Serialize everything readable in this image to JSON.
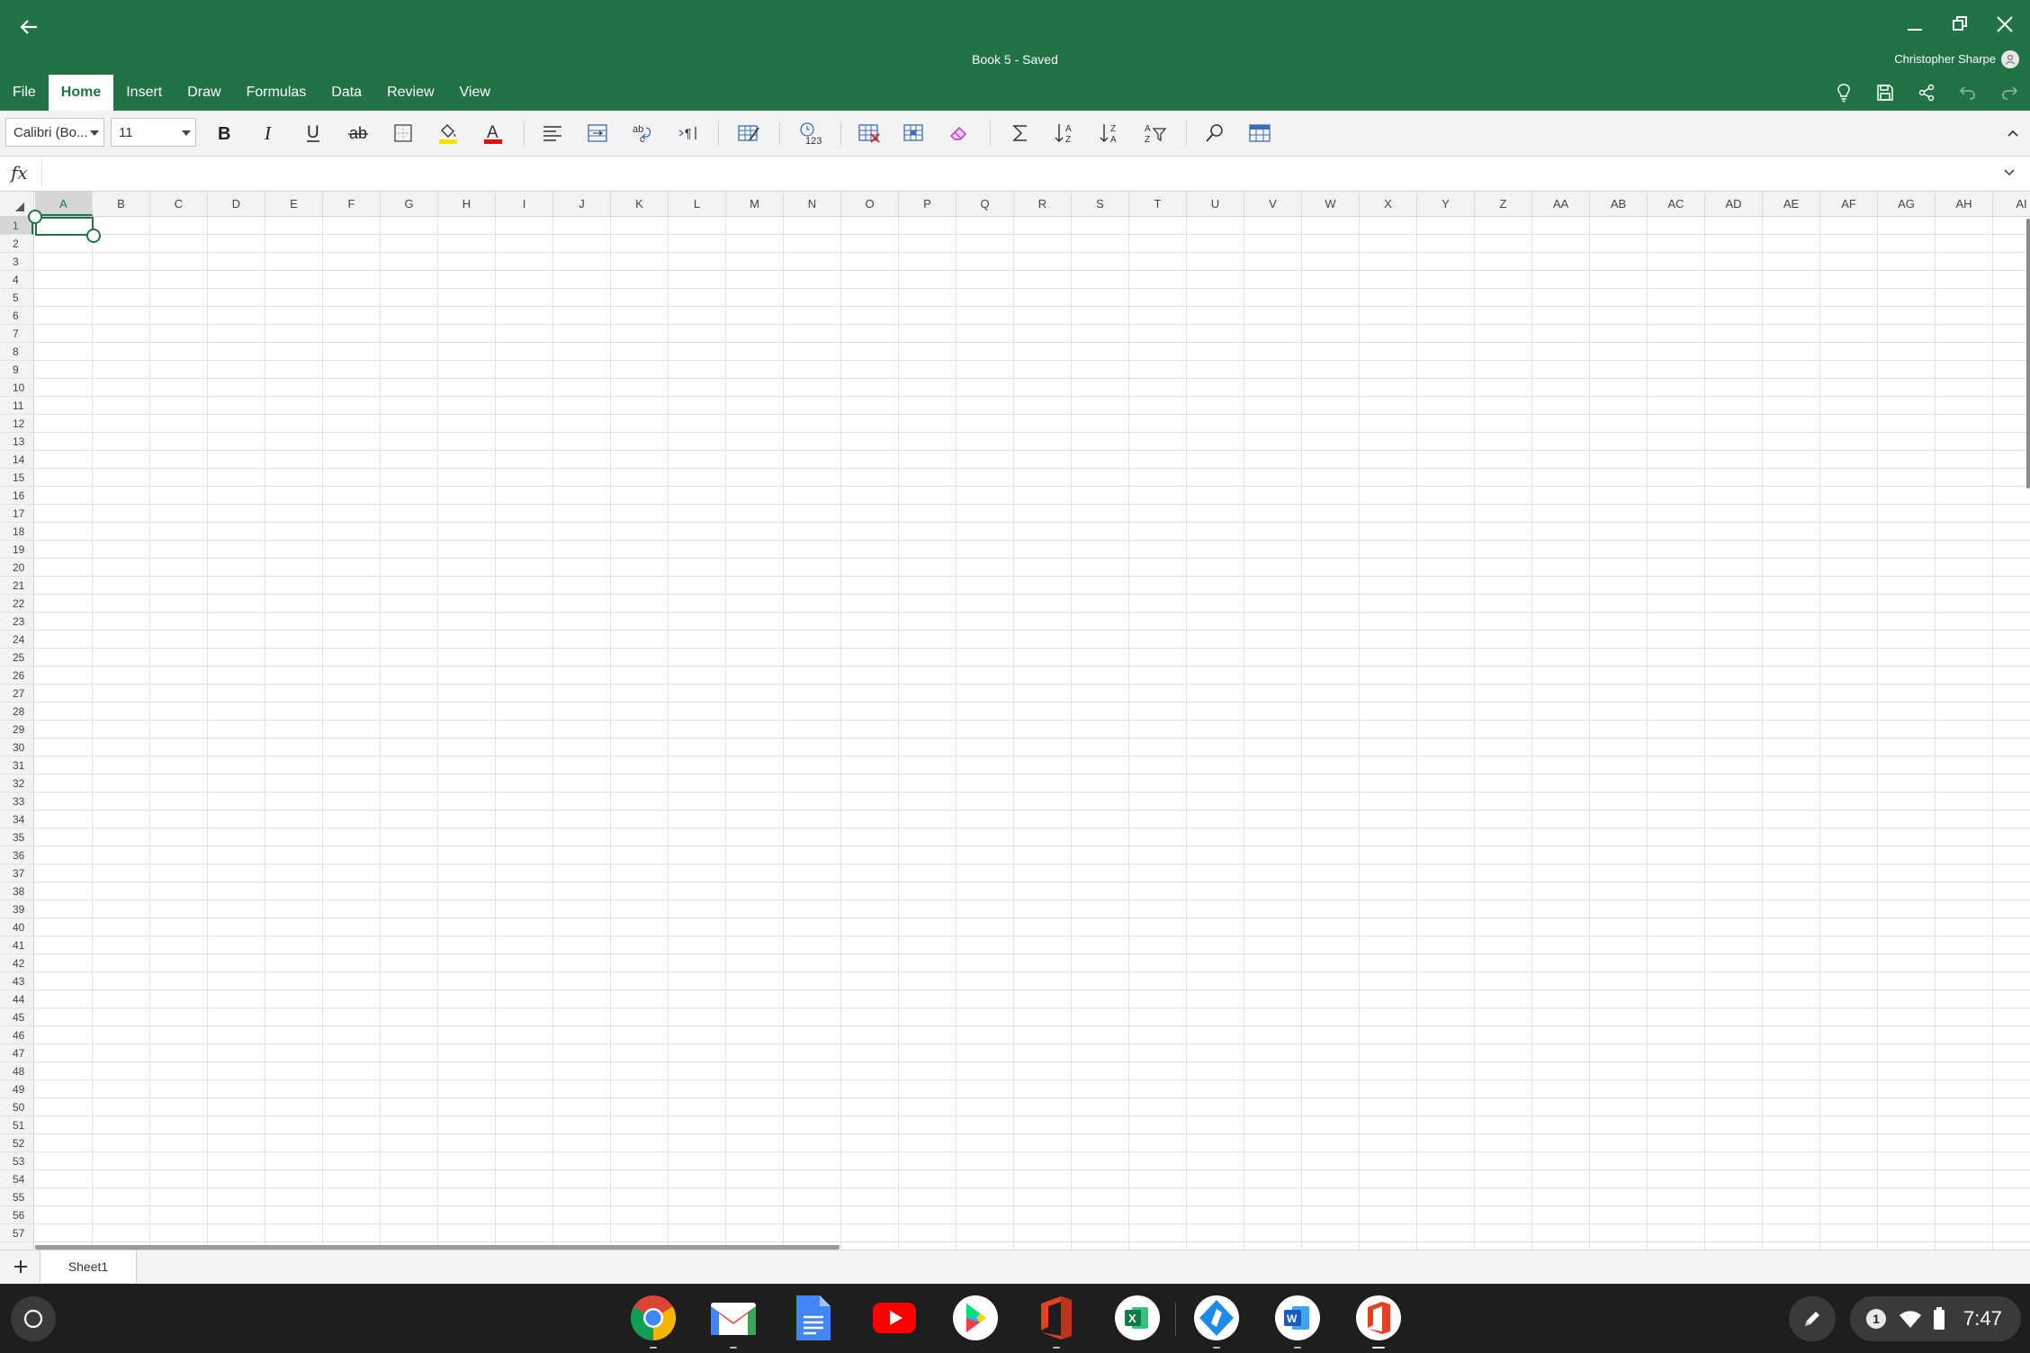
{
  "app": {
    "doc_title": "Book 5 - Saved",
    "user_name": "Christopher Sharpe",
    "accent": "#217346"
  },
  "tabs": [
    {
      "label": "File",
      "active": false
    },
    {
      "label": "Home",
      "active": true
    },
    {
      "label": "Insert",
      "active": false
    },
    {
      "label": "Draw",
      "active": false
    },
    {
      "label": "Formulas",
      "active": false
    },
    {
      "label": "Data",
      "active": false
    },
    {
      "label": "Review",
      "active": false
    },
    {
      "label": "View",
      "active": false
    }
  ],
  "header_icons": [
    "lightbulb-icon",
    "save-icon",
    "share-icon",
    "undo-icon",
    "redo-icon"
  ],
  "ribbon": {
    "font_name": "Calibri (Bo...",
    "font_size": "11",
    "buttons": [
      "bold-icon",
      "italic-icon",
      "underline-icon",
      "strikethrough-icon",
      "borders-icon",
      "fill-color-icon",
      "font-color-icon",
      "align-icon",
      "merge-icon",
      "wrap-text-icon",
      "text-direction-icon",
      "format-table-icon",
      "number-format-icon",
      "delete-cells-icon",
      "format-cells-icon",
      "clear-icon",
      "autosum-icon",
      "sort-ascending-icon",
      "sort-descending-icon",
      "filter-icon",
      "find-icon",
      "table-view-icon"
    ]
  },
  "formula_bar": {
    "fx_label": "fx",
    "value": ""
  },
  "grid": {
    "columns": [
      "A",
      "B",
      "C",
      "D",
      "E",
      "F",
      "G",
      "H",
      "I",
      "J",
      "K",
      "L",
      "M",
      "N",
      "O",
      "P",
      "Q",
      "R",
      "S",
      "T",
      "U",
      "V",
      "W",
      "X",
      "Y",
      "Z",
      "AA",
      "AB",
      "AC",
      "AD",
      "AE",
      "AF",
      "AG",
      "AH",
      "AI"
    ],
    "row_count": 57,
    "selected_cell": "A1"
  },
  "sheets": [
    {
      "label": "Sheet1",
      "active": true
    }
  ],
  "shelf": {
    "apps": [
      "chrome-icon",
      "gmail-icon",
      "docs-icon",
      "youtube-icon",
      "play-store-icon",
      "office-icon",
      "excel-icon",
      "app-icon",
      "word-icon",
      "office-hub-icon"
    ],
    "notification_count": "1",
    "time": "7:47"
  }
}
